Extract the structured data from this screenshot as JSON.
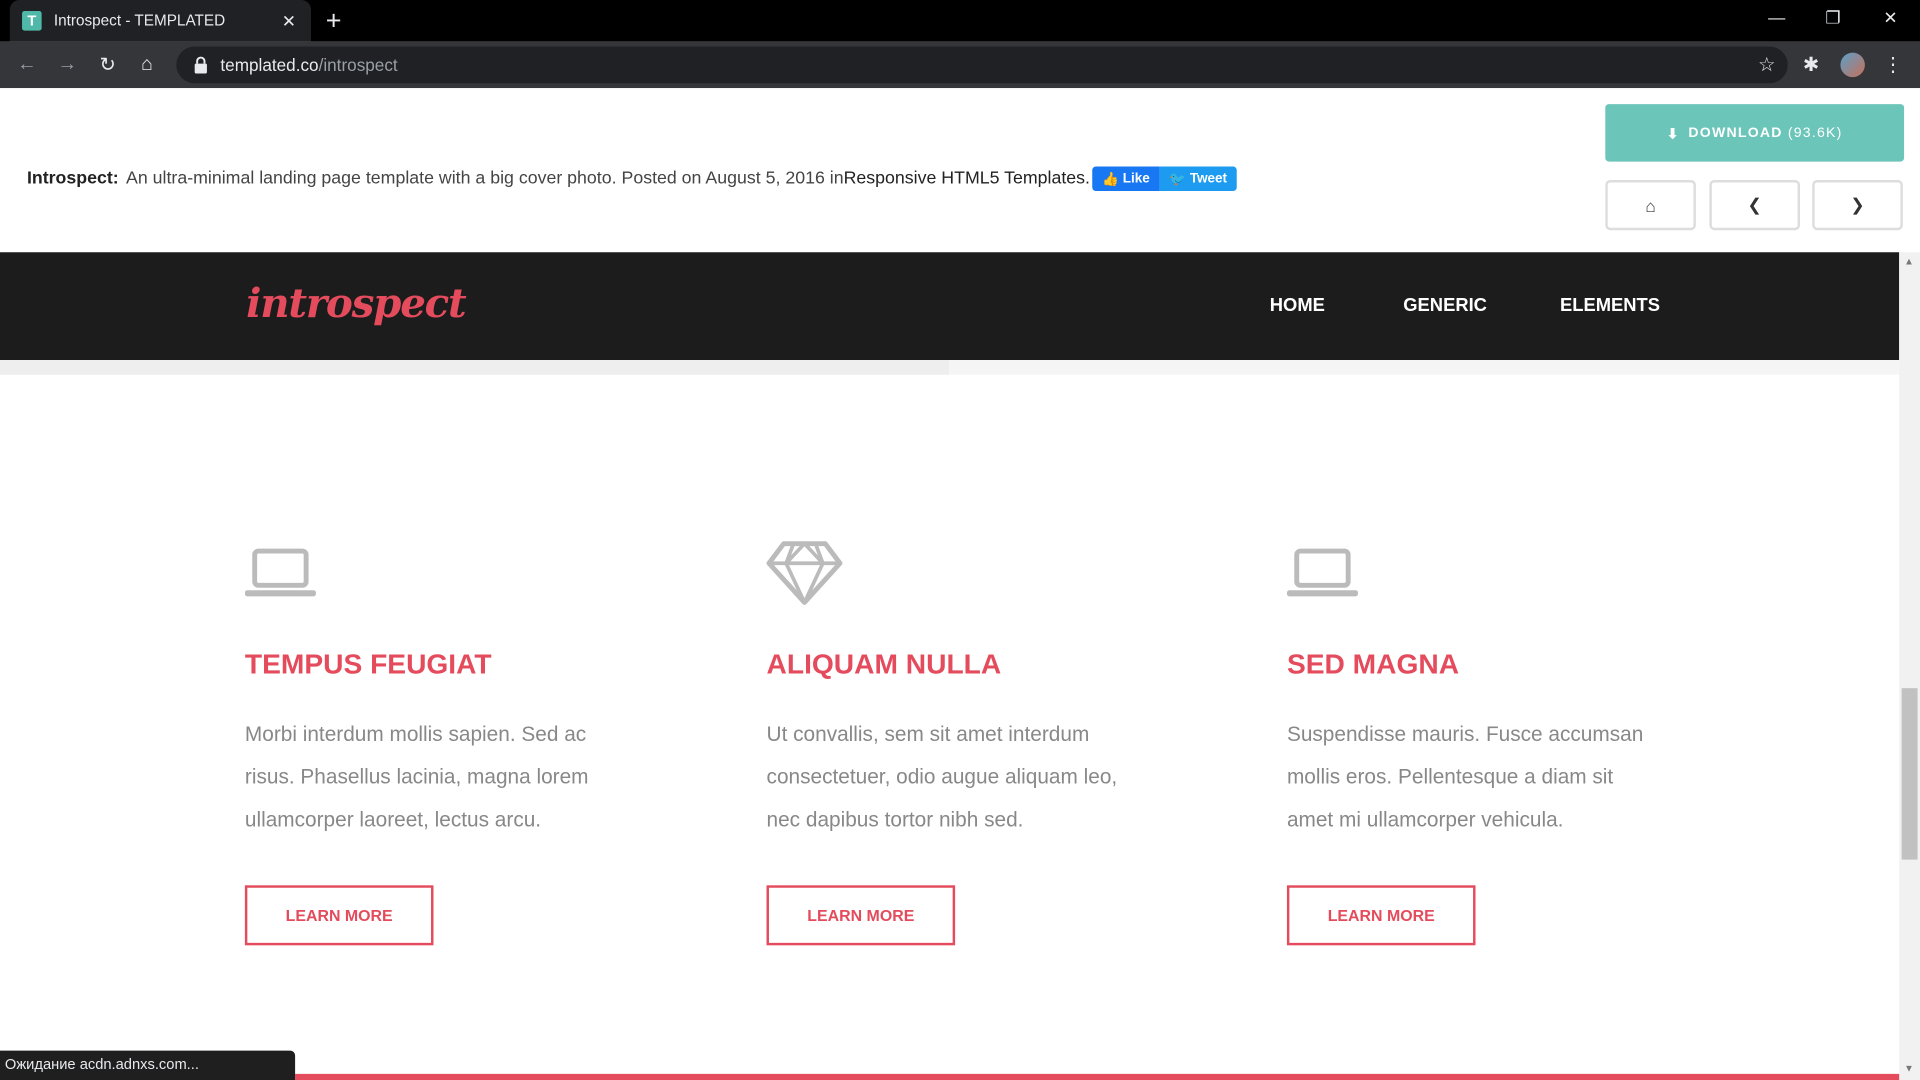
{
  "browser": {
    "tab_title": "Introspect - TEMPLATED",
    "tab_favicon_letter": "T",
    "url_domain": "templated.co",
    "url_path": "/introspect",
    "status_text": "Ожидание acdn.adnxs.com..."
  },
  "templated": {
    "name": "Introspect:",
    "description": "An ultra-minimal landing page template with a big cover photo. Posted on August 5, 2016 in ",
    "category": "Responsive HTML5 Templates.",
    "like_label": "Like",
    "tweet_label": "Tweet",
    "download_label": "DOWNLOAD",
    "download_size": "(93.6K)"
  },
  "site": {
    "logo": "introspect",
    "nav": [
      "HOME",
      "GENERIC",
      "ELEMENTS"
    ]
  },
  "features": [
    {
      "icon": "laptop-icon",
      "title": "TEMPUS FEUGIAT",
      "text": "Morbi interdum mollis sapien. Sed ac risus. Phasellus lacinia, magna lorem ullamcorper laoreet, lectus arcu.",
      "button": "LEARN MORE"
    },
    {
      "icon": "diamond-icon",
      "title": "ALIQUAM NULLA",
      "text": "Ut convallis, sem sit amet interdum consectetuer, odio augue aliquam leo, nec dapibus tortor nibh sed.",
      "button": "LEARN MORE"
    },
    {
      "icon": "laptop-icon",
      "title": "SED MAGNA",
      "text": "Suspendisse mauris. Fusce accumsan mollis eros. Pellentesque a diam sit amet mi ullamcorper vehicula.",
      "button": "LEARN MORE"
    }
  ],
  "colors": {
    "accent": "#e44c5d",
    "download": "#6cc5b9",
    "header_bg": "#1c1c1c"
  }
}
